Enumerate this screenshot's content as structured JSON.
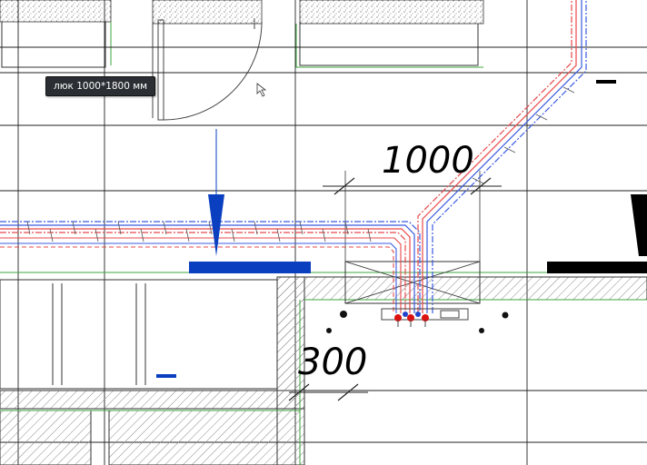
{
  "tooltip": {
    "text": "люк 1000*1800 мм"
  },
  "dimensions": {
    "upper": "1000",
    "lower": "300"
  },
  "colors": {
    "background": "#ffffff",
    "grid_line": "#222222",
    "hot_pipe": "#e8484a",
    "cold_pipe": "#3a5be0",
    "section_marker_blue": "#0a3fc0",
    "section_marker_black": "#000000",
    "wall_hatch": "#7a7a7a",
    "wall_outline_green": "#3da63d",
    "tooltip_bg": "#2b2f33"
  },
  "icons": {
    "cursor": "mouse-pointer-icon",
    "valve": "valve-icon",
    "riser": "riser-dot-icon"
  }
}
